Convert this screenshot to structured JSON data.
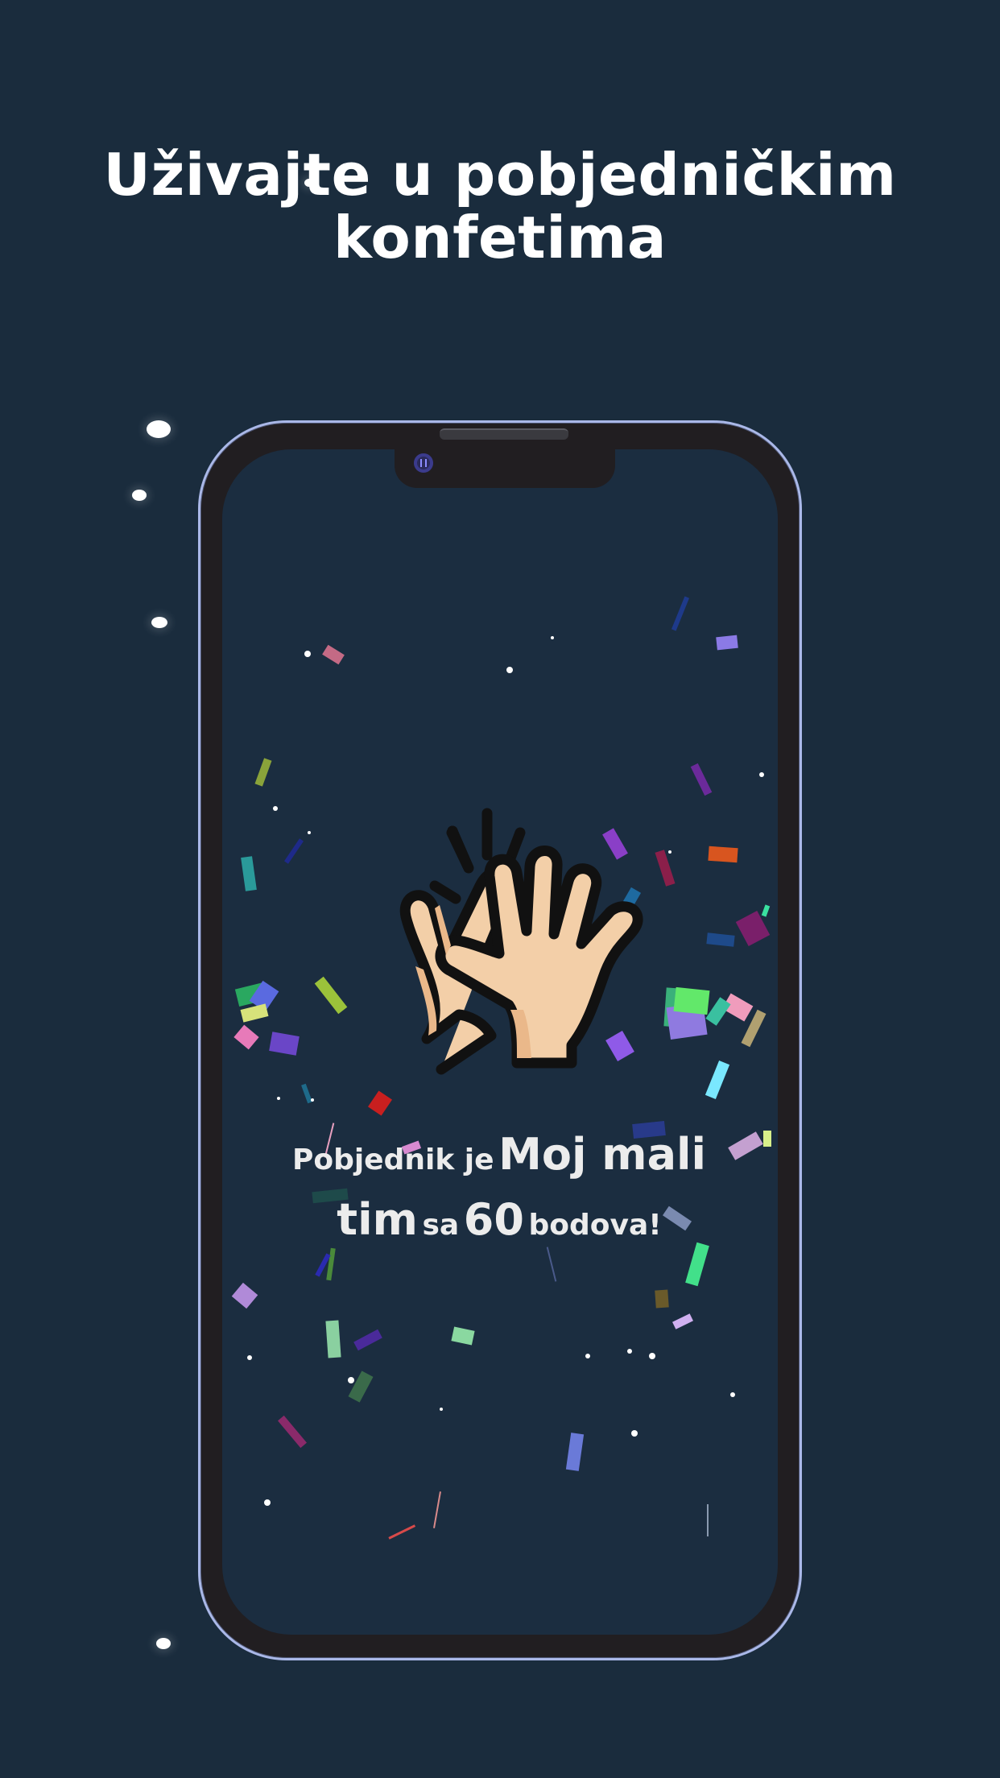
{
  "headline": {
    "line1": "Uživajte u pobjedničkim",
    "line2": "konfetima"
  },
  "phone": {
    "icons": {
      "camera": "camera-icon",
      "illustration": "clapping-hands-icon"
    }
  },
  "winner": {
    "prefix": "Pobjednik je",
    "team": "Moj mali tim",
    "middle": "sa",
    "points": "60",
    "suffix": "bodova!"
  },
  "colors": {
    "background": "#1a2c3d",
    "screen": "#1b2d40",
    "phone_frame": "#211e21",
    "phone_edge": "#aab8e8",
    "skin": "#f3cfa8",
    "skin_shadow": "#eab88a",
    "outline": "#111111",
    "text": "#ececec"
  }
}
